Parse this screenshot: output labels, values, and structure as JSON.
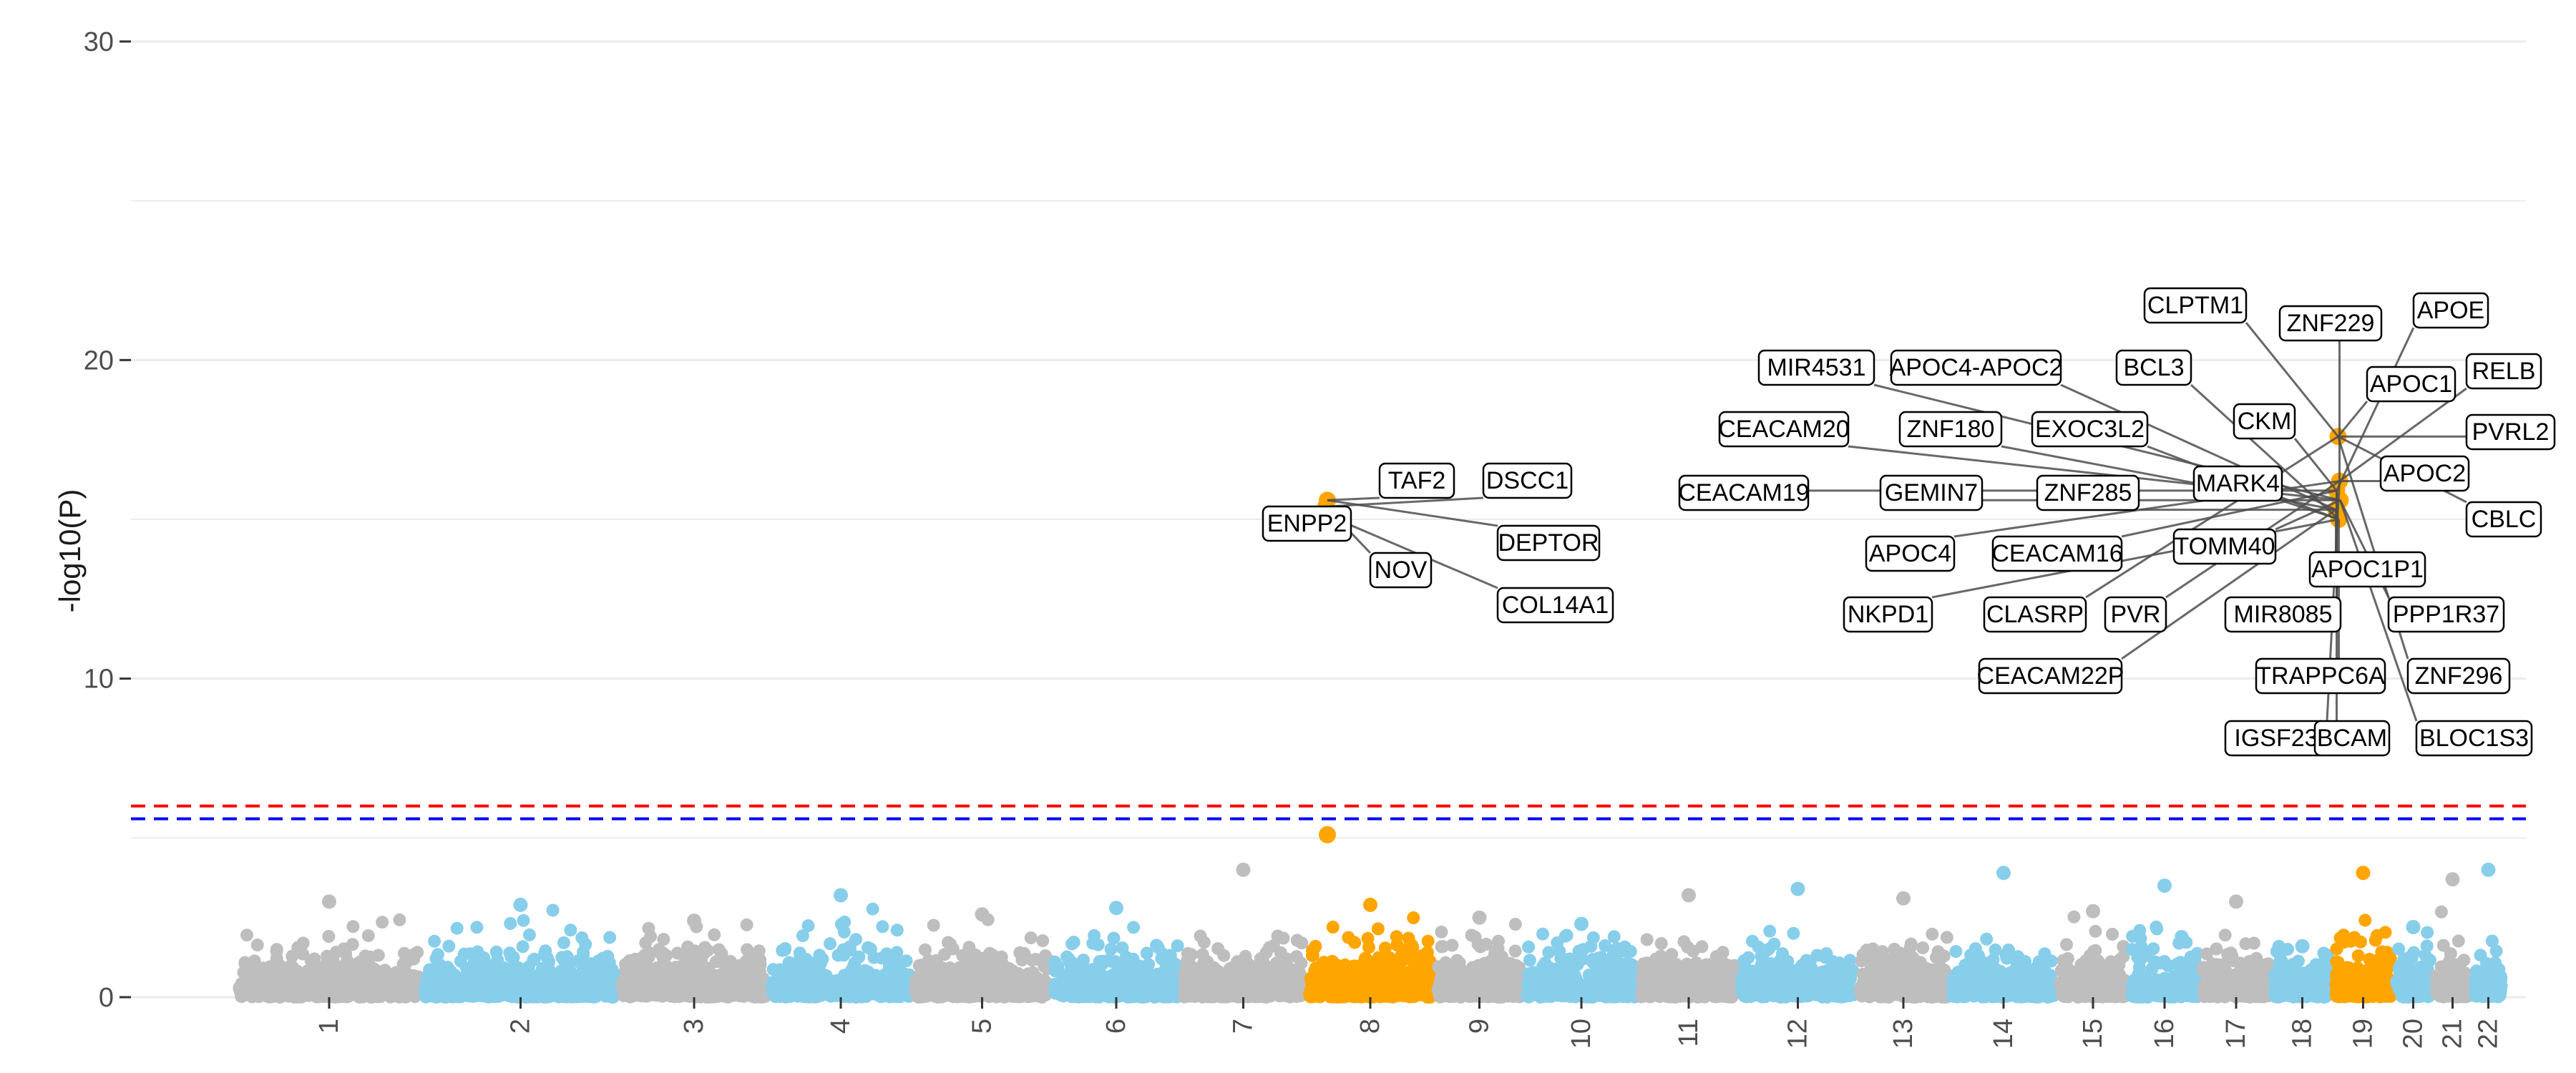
{
  "chart_data": {
    "type": "scatter",
    "title": "",
    "xlabel": "",
    "ylabel": "-log10(P)",
    "ylim": [
      0,
      30
    ],
    "y_ticks": [
      0,
      10,
      20,
      30
    ],
    "grid": true,
    "legend": "none",
    "colors": {
      "odd_chromosome": "#bebebe",
      "even_chromosome": "#87ceeb",
      "highlight": "#ffa500",
      "genome_wide_line": "#ff0000",
      "suggestive_line": "#0000ff",
      "grid": "#ebebeb",
      "connector": "#4d4d4d"
    },
    "thresholds": [
      {
        "name": "genome-wide",
        "y": 6.0,
        "color": "#ff0000"
      },
      {
        "name": "suggestive",
        "y": 5.6,
        "color": "#0000ff"
      }
    ],
    "chromosomes": [
      {
        "label": "1",
        "max_y": 3.0
      },
      {
        "label": "2",
        "max_y": 2.9
      },
      {
        "label": "3",
        "max_y": 2.4
      },
      {
        "label": "4",
        "max_y": 3.2
      },
      {
        "label": "5",
        "max_y": 2.6
      },
      {
        "label": "6",
        "max_y": 2.8
      },
      {
        "label": "7",
        "max_y": 4.0
      },
      {
        "label": "8",
        "max_y": 2.9,
        "highlight": true
      },
      {
        "label": "9",
        "max_y": 2.5
      },
      {
        "label": "10",
        "max_y": 2.3
      },
      {
        "label": "11",
        "max_y": 3.2
      },
      {
        "label": "12",
        "max_y": 3.4
      },
      {
        "label": "13",
        "max_y": 3.1
      },
      {
        "label": "14",
        "max_y": 3.9
      },
      {
        "label": "15",
        "max_y": 2.7
      },
      {
        "label": "16",
        "max_y": 3.5
      },
      {
        "label": "17",
        "max_y": 3.0
      },
      {
        "label": "18",
        "max_y": 1.6
      },
      {
        "label": "19",
        "max_y": 3.9,
        "highlight": true
      },
      {
        "label": "20",
        "max_y": 2.2
      },
      {
        "label": "21",
        "max_y": 3.7
      },
      {
        "label": "22",
        "max_y": 4.0
      }
    ],
    "highlight_points": [
      {
        "chr": "8",
        "y": 15.6
      },
      {
        "chr": "8",
        "y": 15.4
      },
      {
        "chr": "8",
        "y": 15.1
      },
      {
        "chr": "8",
        "y": 5.1
      },
      {
        "chr": "19",
        "y": 17.6
      },
      {
        "chr": "19",
        "y": 16.2
      },
      {
        "chr": "19",
        "y": 15.9
      },
      {
        "chr": "19",
        "y": 15.6
      },
      {
        "chr": "19",
        "y": 15.3
      },
      {
        "chr": "19",
        "y": 15.0
      }
    ],
    "gene_labels": [
      "TAF2",
      "DSCC1",
      "ENPP2",
      "DEPTOR",
      "NOV",
      "COL14A1",
      "CLPTM1",
      "ZNF229",
      "APOE",
      "MIR4531",
      "APOC4-APOC2",
      "BCL3",
      "APOC1",
      "RELB",
      "CKM",
      "CEACAM20",
      "ZNF180",
      "EXOC3L2",
      "PVRL2",
      "APOC2",
      "CEACAM19",
      "GEMIN7",
      "ZNF285",
      "MARK4",
      "CBLC",
      "APOC4",
      "CEACAM16",
      "TOMM40",
      "APOC1P1",
      "NKPD1",
      "CLASRP",
      "PVR",
      "MIR8085",
      "PPP1R37",
      "CEACAM22P",
      "TRAPPC6A",
      "ZNF296",
      "IGSF23",
      "BCAM",
      "BLOC1S3"
    ]
  }
}
